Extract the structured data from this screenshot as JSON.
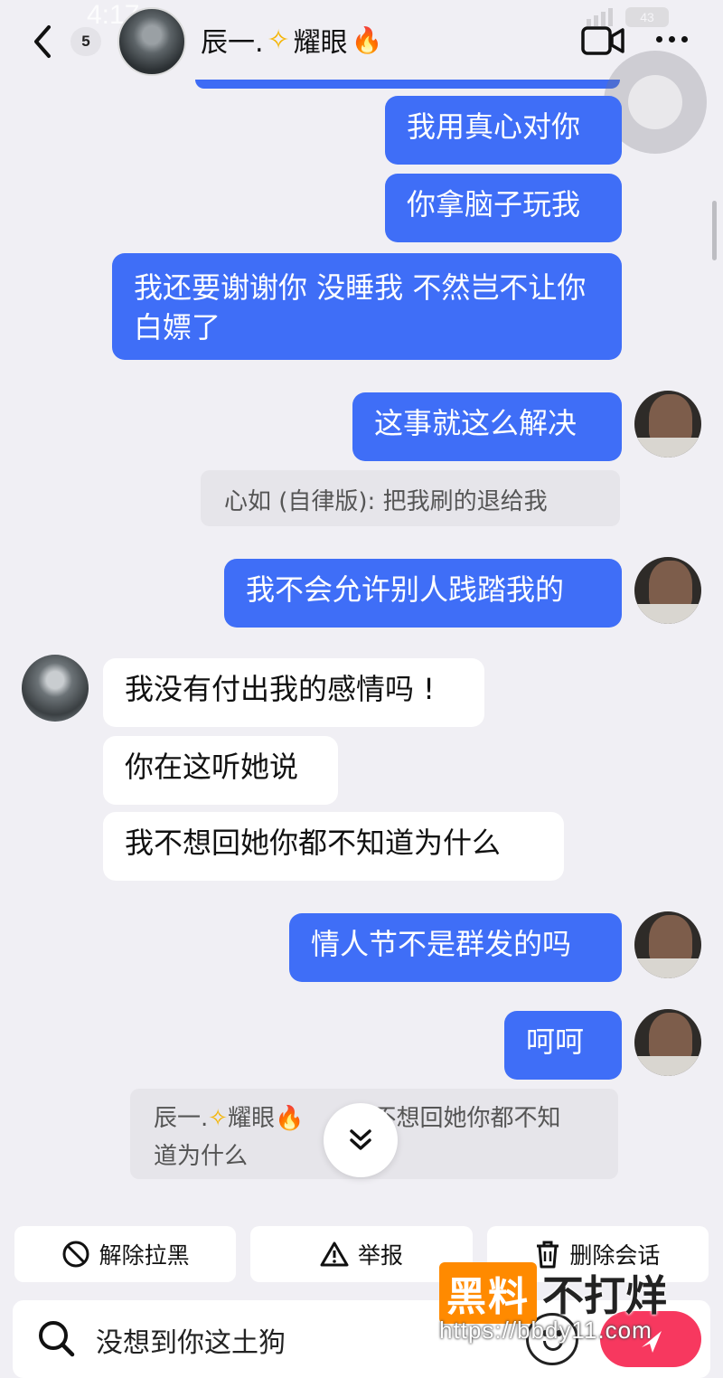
{
  "status": {
    "time": "4:17",
    "battery": "43"
  },
  "header": {
    "back_count": "5",
    "name": "辰一.",
    "name_suffix": "耀眼"
  },
  "messages": [
    {
      "text": "我用真心对你"
    },
    {
      "text": "你拿脑子玩我"
    },
    {
      "text": "我还要谢谢你 没睡我 不然岂不让你白嫖了"
    },
    {
      "text": "这事就这么解决"
    },
    {
      "text": "心如 (自律版): 把我刷的退给我"
    },
    {
      "text": "我不会允许别人践踏我的"
    },
    {
      "text": "我没有付出我的感情吗 !"
    },
    {
      "text": "你在这听她说"
    },
    {
      "text": "我不想回她你都不知道为什么"
    },
    {
      "text": "情人节不是群发的吗"
    },
    {
      "text": "呵呵"
    }
  ],
  "quote": {
    "name": "辰一.",
    "name_suffix": "耀眼",
    "text_a": "不想回她你都不知",
    "text_b": "道为什么"
  },
  "actions": {
    "unblock": "解除拉黑",
    "report": "举报",
    "delete": "删除会话"
  },
  "input": {
    "text": "没想到你这土狗"
  },
  "watermark": {
    "box": "黑料",
    "text": "不打烊",
    "url": "https://bbdy11.com"
  },
  "colors": {
    "outgoing_bubble": "#3f6ef7",
    "send_button": "#f7385f",
    "watermark_accent": "#ff8a00"
  }
}
